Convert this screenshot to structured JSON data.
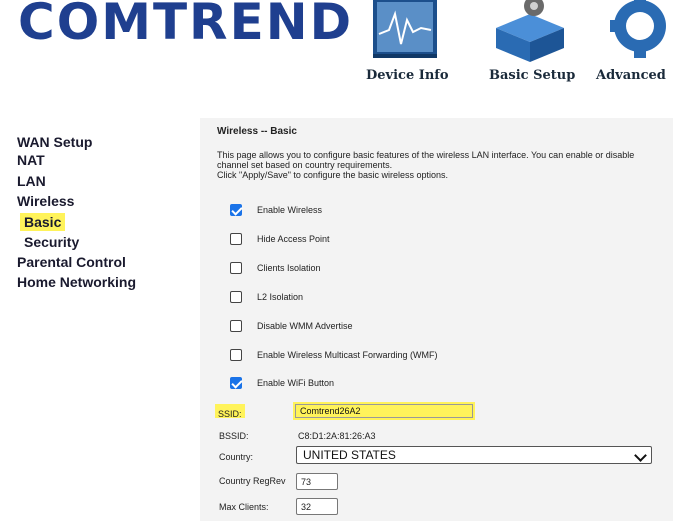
{
  "header": {
    "logo": "COMTREND",
    "nav": [
      {
        "label": "Device Info",
        "icon": "monitor-chart-icon"
      },
      {
        "label": "Basic Setup",
        "icon": "box-gear-icon"
      },
      {
        "label": "Advanced",
        "icon": "gear-icon"
      }
    ]
  },
  "sidebar": {
    "items": [
      {
        "label": "WAN Setup"
      },
      {
        "label": "NAT"
      },
      {
        "label": "LAN"
      },
      {
        "label": "Wireless"
      },
      {
        "label": "Basic"
      },
      {
        "label": "Security"
      },
      {
        "label": "Parental Control"
      },
      {
        "label": "Home Networking"
      }
    ]
  },
  "main": {
    "title": "Wireless -- Basic",
    "description": [
      "This page allows you to configure basic features of the wireless LAN interface. You can enable or disable",
      "channel set based on country requirements.",
      "Click \"Apply/Save\" to configure the basic wireless options."
    ],
    "options": [
      {
        "label": "Enable Wireless",
        "checked": true
      },
      {
        "label": "Hide Access Point",
        "checked": false
      },
      {
        "label": "Clients Isolation",
        "checked": false
      },
      {
        "label": "L2 Isolation",
        "checked": false
      },
      {
        "label": "Disable WMM Advertise",
        "checked": false
      },
      {
        "label": "Enable Wireless Multicast Forwarding (WMF)",
        "checked": false
      },
      {
        "label": "Enable WiFi Button",
        "checked": true
      }
    ],
    "ssid": {
      "label": "SSID:",
      "value": "Comtrend26A2"
    },
    "bssid": {
      "label": "BSSID:",
      "value": "C8:D1:2A:81:26:A3"
    },
    "country": {
      "label": "Country:",
      "value": "UNITED STATES"
    },
    "country_regrev": {
      "label": "Country RegRev",
      "value": "73"
    },
    "max_clients": {
      "label": "Max Clients:",
      "value": "32"
    }
  },
  "colors": {
    "highlight": "#fff35a",
    "logo": "#1f3f8f",
    "checkbox": "#1a73e8"
  }
}
